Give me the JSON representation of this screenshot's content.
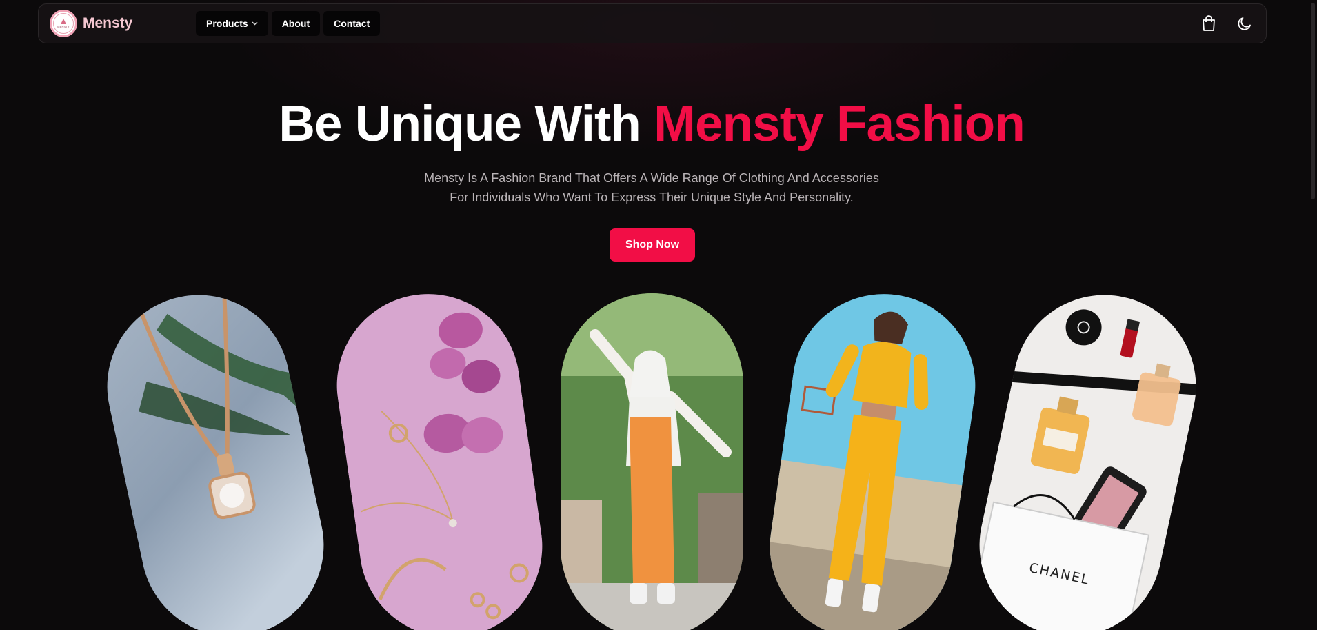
{
  "nav": {
    "brand": "Mensty",
    "logo_text": "MENSTY",
    "links": [
      {
        "label": "Products",
        "has_dropdown": true
      },
      {
        "label": "About"
      },
      {
        "label": "Contact"
      }
    ],
    "icons": [
      "shopping-bag-icon",
      "moon-icon"
    ]
  },
  "hero": {
    "title_main": "Be Unique With ",
    "title_accent": "Mensty Fashion",
    "subtitle_line1": "Mensty Is A Fashion Brand That Offers A Wide Range Of Clothing And Accessories",
    "subtitle_line2": "For Individuals Who Want To Express Their Unique Style And Personality.",
    "cta_label": "Shop Now"
  },
  "gallery": {
    "perfume_brand": "CHANEL",
    "items": [
      "necklace-photo",
      "jewelry-flowers-photo",
      "woman-orange-outfit-photo",
      "woman-yellow-tracksuit-photo",
      "perfume-cosmetics-photo"
    ]
  },
  "colors": {
    "accent": "#f20e46",
    "background": "#0c0a0b",
    "brand_text": "#f4c6d0"
  }
}
